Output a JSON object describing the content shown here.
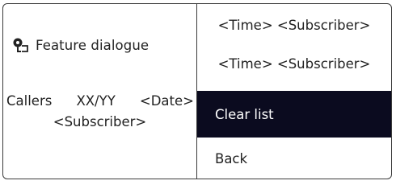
{
  "left_panel": {
    "feature_label": "Feature dialogue",
    "feature_icon": "feature-key-icon",
    "callers_label": "Callers",
    "count": "XX/YY",
    "date": "<Date>",
    "subscriber": "<Subscriber>"
  },
  "menu": {
    "items": [
      {
        "label": "<Time> <Subscriber>"
      },
      {
        "label": "<Time> <Subscriber>"
      },
      {
        "label": "Clear list",
        "selected": true
      },
      {
        "label": "Back"
      }
    ]
  },
  "colors": {
    "selected_bg": "#0b0b1f",
    "selected_text": "#ffffff",
    "border": "#3a3a3a"
  }
}
